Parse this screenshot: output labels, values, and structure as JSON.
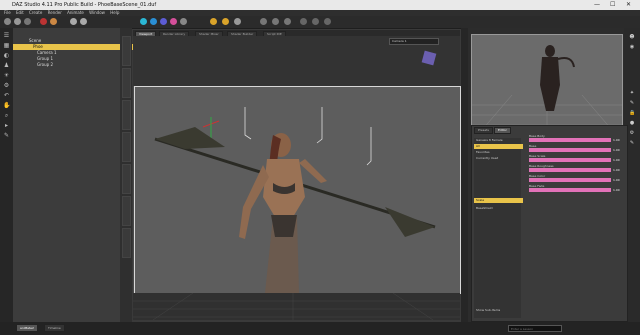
{
  "window": {
    "title": "DAZ Studio 4.11 Pro Public Build - PhoeBaseScene_01.duf",
    "controls": [
      "—",
      "☐",
      "✕"
    ]
  },
  "menu": [
    "File",
    "Edit",
    "Create",
    "Render",
    "Animate",
    "Window",
    "Help"
  ],
  "scene": {
    "root_label": "Scene",
    "items": [
      {
        "label": "Phoe",
        "selected": true
      },
      {
        "label": "Camera 1",
        "selected": false
      },
      {
        "label": "Group 1",
        "selected": false
      },
      {
        "label": "Group 2",
        "selected": false
      }
    ]
  },
  "viewport": {
    "tabs": [
      {
        "label": "Viewport",
        "active": true
      },
      {
        "label": "Render Library",
        "active": false
      },
      {
        "label": "Shader Mixer",
        "active": false
      },
      {
        "label": "Shader Builder",
        "active": false
      },
      {
        "label": "Script IDE",
        "active": false
      }
    ],
    "camera_select": "Camera 1"
  },
  "surfaces": {
    "tabs": [
      {
        "label": "Presets",
        "active": false
      },
      {
        "label": "Editor",
        "active": true
      }
    ],
    "materials": [
      {
        "label": "Genesis 8 Female",
        "selected": false
      },
      {
        "label": "All",
        "selected": false
      },
      {
        "label": "Favorites",
        "selected": false
      },
      {
        "label": "Currently Used",
        "selected": false
      },
      {
        "label": "Scale",
        "selected": true
      },
      {
        "label": "BaseShield",
        "selected": false
      }
    ],
    "props": [
      {
        "label": "Base Body",
        "value": "1.00"
      },
      {
        "label": "Base",
        "value": "1.00"
      },
      {
        "label": "Base Scale",
        "value": "1.00"
      },
      {
        "label": "Base Roughness",
        "value": "1.00"
      },
      {
        "label": "Base Color",
        "value": "1.00"
      },
      {
        "label": "Base Fade",
        "value": "1.00"
      }
    ],
    "filter_label": "Show Sub-Items"
  },
  "bottom_tabs": [
    {
      "label": "aniMate2",
      "active": true
    },
    {
      "label": "Timeline",
      "active": false
    }
  ],
  "status": {
    "search_placeholder": "Enter a Lesson"
  },
  "colors": {
    "accent": "#e9c44a",
    "slider": "#e272b8",
    "bg": "#3a3a3a"
  }
}
